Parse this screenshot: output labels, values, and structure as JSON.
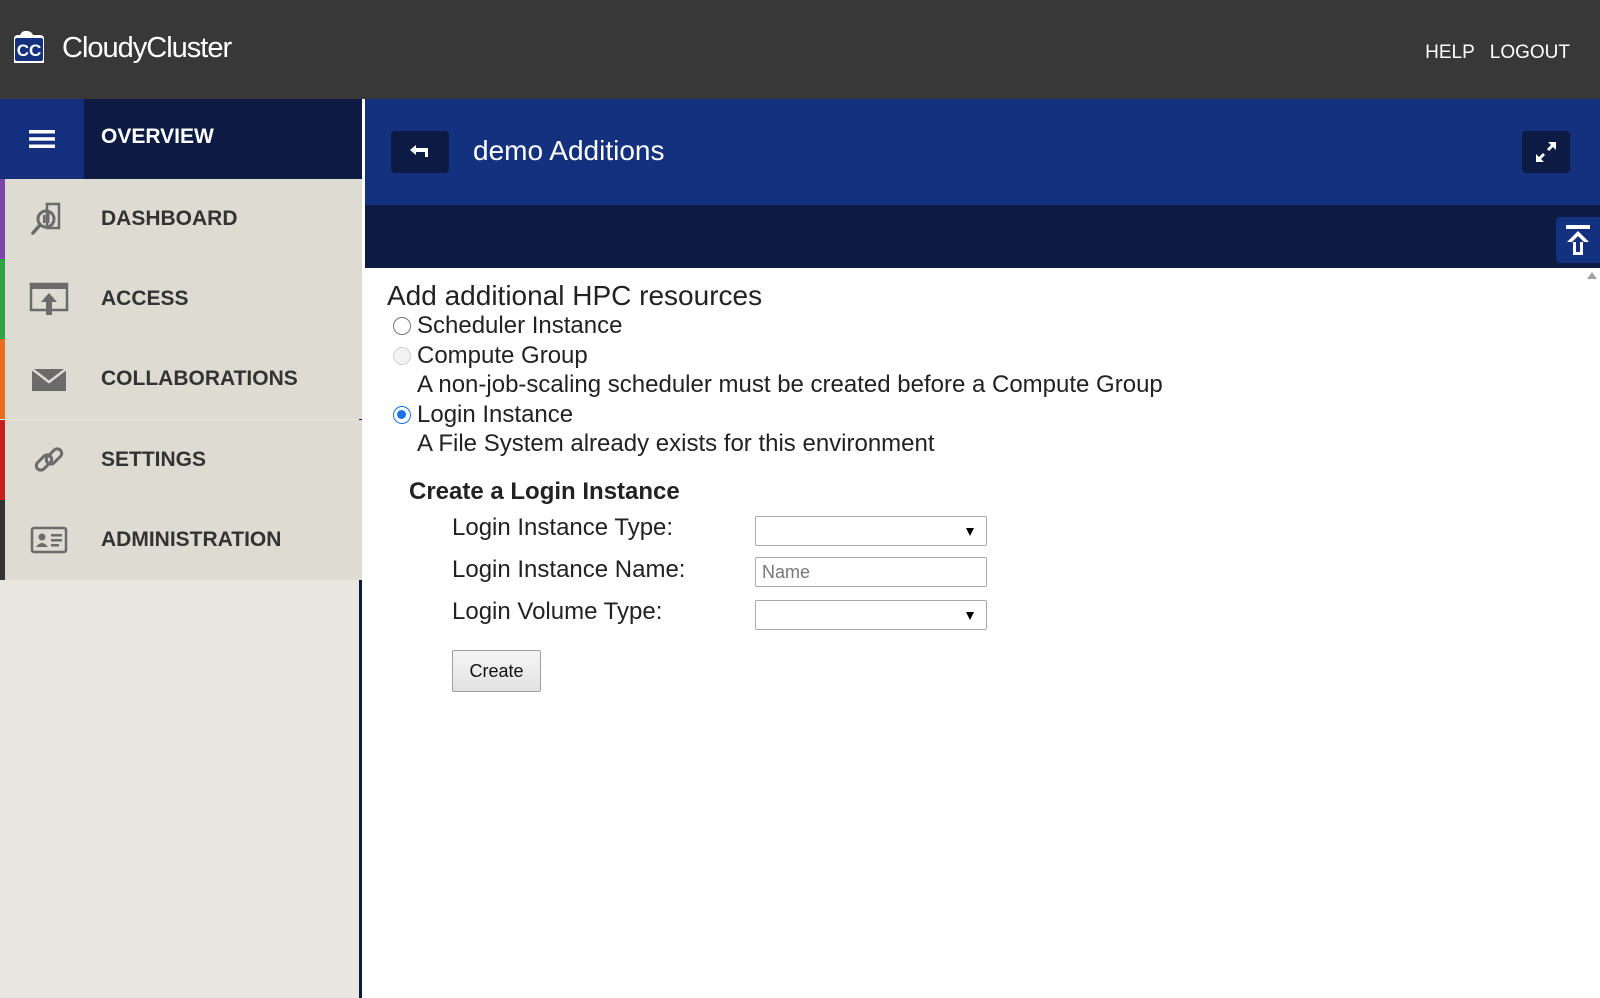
{
  "app": {
    "brand": "CloudyCluster",
    "logo_text": "CC",
    "top_links": [
      "HELP",
      "LOGOUT"
    ]
  },
  "sidebar": {
    "header_label": "OVERVIEW",
    "items": [
      {
        "label": "DASHBOARD",
        "icon": "dashboard-icon",
        "accent": "#7a46a8"
      },
      {
        "label": "ACCESS",
        "icon": "access-icon",
        "accent": "#2ea343"
      },
      {
        "label": "COLLABORATIONS",
        "icon": "envelope-icon",
        "accent": "#e86d1c"
      },
      {
        "label": "SETTINGS",
        "icon": "link-icon",
        "accent": "#c4211f"
      },
      {
        "label": "ADMINISTRATION",
        "icon": "id-card-icon",
        "accent": "#333333"
      }
    ]
  },
  "content": {
    "title": "demo Additions"
  },
  "resources": {
    "heading": "Add additional HPC resources",
    "options": [
      {
        "label": "Scheduler Instance",
        "checked": false,
        "disabled": false
      },
      {
        "label": "Compute Group",
        "checked": false,
        "disabled": true,
        "note": "A non-job-scaling scheduler must be created before a Compute Group"
      },
      {
        "label": "Login Instance",
        "checked": true,
        "disabled": false,
        "note": "A File System already exists for this environment"
      }
    ]
  },
  "login_form": {
    "heading": "Create a Login Instance",
    "instance_type_label": "Login Instance Type:",
    "instance_type_value": "",
    "instance_name_label": "Login Instance Name:",
    "instance_name_placeholder": "Name",
    "volume_type_label": "Login Volume Type:",
    "volume_type_value": "",
    "create_label": "Create"
  },
  "colors": {
    "topbar": "#383838",
    "nav_dark": "#0d1b44",
    "nav_blue": "#14317f",
    "sidebar_bg": "#e8e7df",
    "radio_checked": "#1a73e8"
  }
}
